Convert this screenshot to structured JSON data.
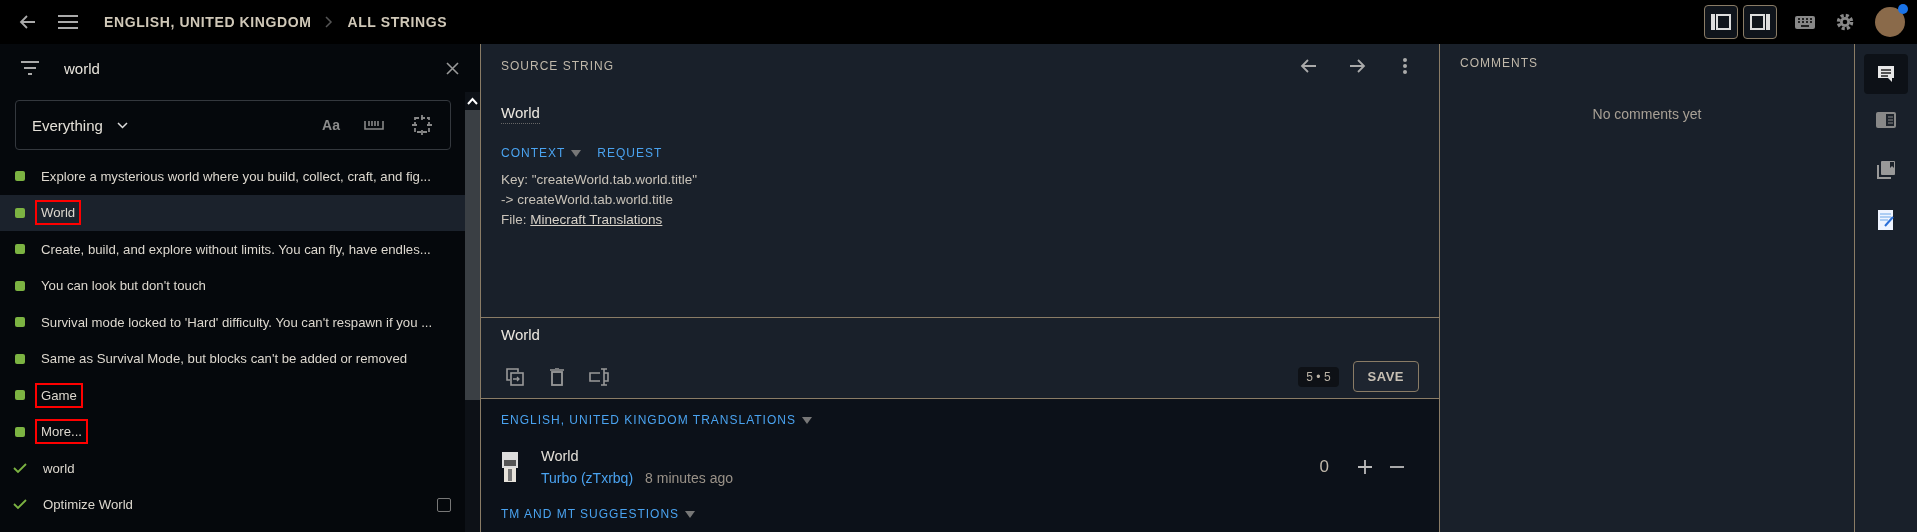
{
  "top_bar": {
    "breadcrumbs": [
      "ENGLISH, UNITED KINGDOM",
      "ALL STRINGS"
    ],
    "avatar": {
      "has_notification": true
    }
  },
  "search": {
    "value": "world"
  },
  "filter": {
    "scope": "Everything",
    "case_toggle": "Aa"
  },
  "strings": [
    {
      "kind": "square",
      "text": "Explore a mysterious world where you build, collect, craft, and fig...",
      "selected": false,
      "highlighted": false
    },
    {
      "kind": "square",
      "text": "World",
      "selected": true,
      "highlighted": true
    },
    {
      "kind": "square",
      "text": "Create, build, and explore without limits. You can fly, have endles...",
      "selected": false,
      "highlighted": false
    },
    {
      "kind": "square",
      "text": "You can look but don't touch",
      "selected": false,
      "highlighted": false
    },
    {
      "kind": "square",
      "text": "Survival mode locked to 'Hard' difficulty. You can't respawn if you ...",
      "selected": false,
      "highlighted": false
    },
    {
      "kind": "square",
      "text": "Same as Survival Mode, but blocks can't be added or removed",
      "selected": false,
      "highlighted": false
    },
    {
      "kind": "square",
      "text": "Game",
      "selected": false,
      "highlighted": true
    },
    {
      "kind": "square",
      "text": "More...",
      "selected": false,
      "highlighted": true
    },
    {
      "kind": "check",
      "text": "world",
      "selected": false,
      "highlighted": false
    },
    {
      "kind": "check",
      "text": "Optimize World",
      "selected": false,
      "highlighted": false,
      "checkbox": {
        "checked": false
      }
    }
  ],
  "source": {
    "header": "SOURCE STRING",
    "text": "World",
    "context_tabs": [
      {
        "label": "CONTEXT",
        "caret": true
      },
      {
        "label": "REQUEST",
        "caret": false
      }
    ],
    "key_line": "Key: \"createWorld.tab.world.title\"",
    "path_line": "-> createWorld.tab.world.title",
    "file_label": "File:",
    "file_link": "Minecraft Translations"
  },
  "editor": {
    "value": "World",
    "counter": "5 • 5",
    "save": "SAVE"
  },
  "translations": {
    "header": "ENGLISH, UNITED KINGDOM TRANSLATIONS",
    "items": [
      {
        "text": "World",
        "author": "Turbo (zTxrbq)",
        "time": "8 minutes ago",
        "votes": "0"
      }
    ]
  },
  "suggestions": {
    "header": "TM AND MT SUGGESTIONS"
  },
  "comments": {
    "header": "COMMENTS",
    "empty": "No comments yet"
  },
  "rail": [
    {
      "kind": "comments",
      "selected": true
    },
    {
      "kind": "preview",
      "selected": false
    },
    {
      "kind": "glossary",
      "selected": false
    },
    {
      "kind": "notes",
      "selected": false
    }
  ]
}
